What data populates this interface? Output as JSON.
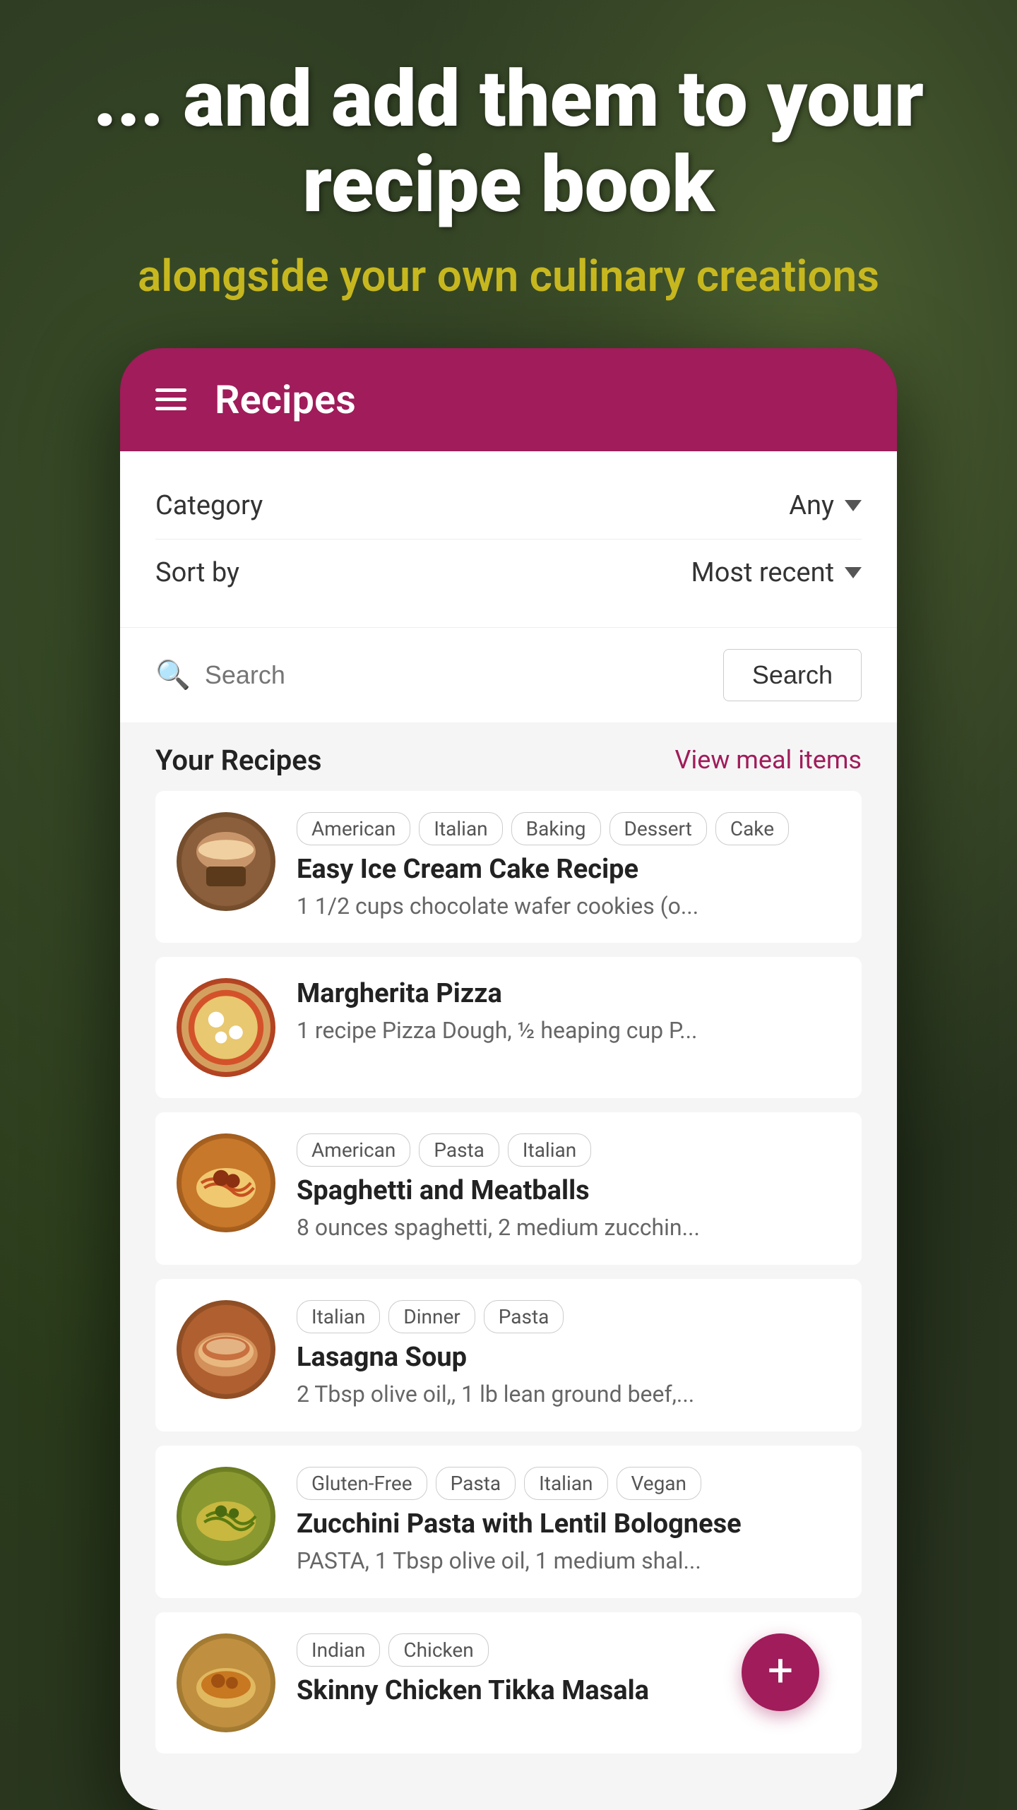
{
  "hero": {
    "title": "... and add them to your recipe book",
    "subtitle": "alongside your own culinary creations"
  },
  "app": {
    "header": {
      "title": "Recipes",
      "menu_icon": "hamburger-menu"
    },
    "filters": {
      "category_label": "Category",
      "category_value": "Any",
      "sort_label": "Sort by",
      "sort_value": "Most recent"
    },
    "search": {
      "placeholder": "Search",
      "button_label": "Search"
    },
    "recipes_section_title": "Your Recipes",
    "view_meal_items_label": "View meal items",
    "recipes": [
      {
        "id": "ice-cream-cake",
        "name": "Easy Ice Cream Cake Recipe",
        "description": "1 1/2 cups chocolate wafer cookies (o...",
        "tags": [
          "American",
          "Italian",
          "Baking",
          "Dessert",
          "Cake"
        ],
        "image_type": "cake"
      },
      {
        "id": "margherita-pizza",
        "name": "Margherita Pizza",
        "description": "1 recipe Pizza Dough, ½ heaping cup P...",
        "tags": [],
        "image_type": "pizza"
      },
      {
        "id": "spaghetti-meatballs",
        "name": "Spaghetti and Meatballs",
        "description": "8 ounces spaghetti, 2 medium zucchin...",
        "tags": [
          "American",
          "Pasta",
          "Italian"
        ],
        "image_type": "spaghetti"
      },
      {
        "id": "lasagna-soup",
        "name": "Lasagna Soup",
        "description": "2 Tbsp olive oil,, 1 lb lean ground beef,...",
        "tags": [
          "Italian",
          "Dinner",
          "Pasta"
        ],
        "image_type": "lasagna"
      },
      {
        "id": "zucchini-pasta",
        "name": "Zucchini Pasta with Lentil Bolognese",
        "description": "PASTA, 1 Tbsp olive oil, 1 medium shal...",
        "tags": [
          "Gluten-Free",
          "Pasta",
          "Italian",
          "Vegan"
        ],
        "image_type": "zucchini"
      },
      {
        "id": "skinny-chicken",
        "name": "Skinny Chicken Tikka Masala",
        "description": "",
        "tags": [
          "Indian",
          "Chicken"
        ],
        "image_type": "chicken"
      }
    ],
    "fab": {
      "label": "+"
    }
  }
}
